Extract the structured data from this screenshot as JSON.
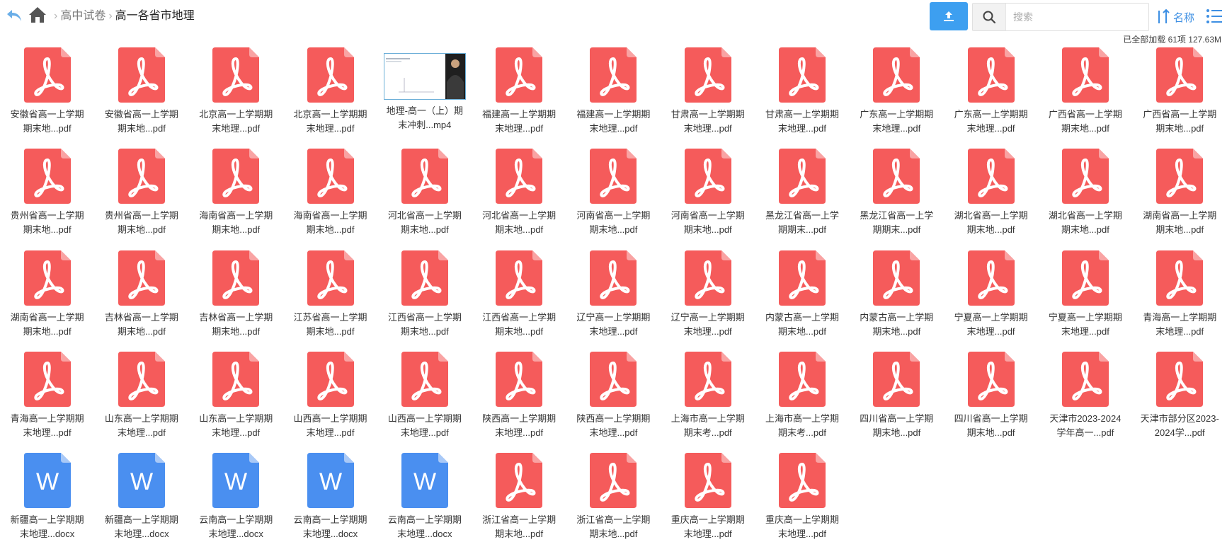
{
  "colors": {
    "pdf": "#f55b5b",
    "pdf_fold": "#f9a3a3",
    "word": "#4a8ff0",
    "word_fold": "#a9c9f7",
    "accent": "#3d9ff0",
    "link": "#3d8fe3"
  },
  "toolbar": {
    "back_icon": "back-arrow-icon",
    "home_icon": "home-icon",
    "upload_icon": "upload-icon",
    "search_icon": "magnifier-icon",
    "search_placeholder": "搜索",
    "sort_label": "名称",
    "sort_icon": "sort-ascending-icon",
    "view_icon": "list-view-icon"
  },
  "breadcrumb": {
    "parent": "高中试卷",
    "current": "高一各省市地理"
  },
  "status": "已全部加载 61项 127.63M",
  "files": [
    {
      "type": "pdf",
      "line1": "安徽省高一上学期",
      "line2": "期末地...pdf"
    },
    {
      "type": "pdf",
      "line1": "安徽省高一上学期",
      "line2": "期末地...pdf"
    },
    {
      "type": "pdf",
      "line1": "北京高一上学期期",
      "line2": "末地理...pdf"
    },
    {
      "type": "pdf",
      "line1": "北京高一上学期期",
      "line2": "末地理...pdf"
    },
    {
      "type": "mp4",
      "line1": "地理-高一（上）期",
      "line2": "末冲刺...mp4"
    },
    {
      "type": "pdf",
      "line1": "福建高一上学期期",
      "line2": "末地理...pdf"
    },
    {
      "type": "pdf",
      "line1": "福建高一上学期期",
      "line2": "末地理...pdf"
    },
    {
      "type": "pdf",
      "line1": "甘肃高一上学期期",
      "line2": "末地理...pdf"
    },
    {
      "type": "pdf",
      "line1": "甘肃高一上学期期",
      "line2": "末地理...pdf"
    },
    {
      "type": "pdf",
      "line1": "广东高一上学期期",
      "line2": "末地理...pdf"
    },
    {
      "type": "pdf",
      "line1": "广东高一上学期期",
      "line2": "末地理...pdf"
    },
    {
      "type": "pdf",
      "line1": "广西省高一上学期",
      "line2": "期末地...pdf"
    },
    {
      "type": "pdf",
      "line1": "广西省高一上学期",
      "line2": "期末地...pdf"
    },
    {
      "type": "pdf",
      "line1": "贵州省高一上学期",
      "line2": "期末地...pdf"
    },
    {
      "type": "pdf",
      "line1": "贵州省高一上学期",
      "line2": "期末地...pdf"
    },
    {
      "type": "pdf",
      "line1": "海南省高一上学期",
      "line2": "期末地...pdf"
    },
    {
      "type": "pdf",
      "line1": "海南省高一上学期",
      "line2": "期末地...pdf"
    },
    {
      "type": "pdf",
      "line1": "河北省高一上学期",
      "line2": "期末地...pdf"
    },
    {
      "type": "pdf",
      "line1": "河北省高一上学期",
      "line2": "期末地...pdf"
    },
    {
      "type": "pdf",
      "line1": "河南省高一上学期",
      "line2": "期末地...pdf"
    },
    {
      "type": "pdf",
      "line1": "河南省高一上学期",
      "line2": "期末地...pdf"
    },
    {
      "type": "pdf",
      "line1": "黑龙江省高一上学",
      "line2": "期期末...pdf"
    },
    {
      "type": "pdf",
      "line1": "黑龙江省高一上学",
      "line2": "期期末...pdf"
    },
    {
      "type": "pdf",
      "line1": "湖北省高一上学期",
      "line2": "期末地...pdf"
    },
    {
      "type": "pdf",
      "line1": "湖北省高一上学期",
      "line2": "期末地...pdf"
    },
    {
      "type": "pdf",
      "line1": "湖南省高一上学期",
      "line2": "期末地...pdf"
    },
    {
      "type": "pdf",
      "line1": "湖南省高一上学期",
      "line2": "期末地...pdf"
    },
    {
      "type": "pdf",
      "line1": "吉林省高一上学期",
      "line2": "期末地...pdf"
    },
    {
      "type": "pdf",
      "line1": "吉林省高一上学期",
      "line2": "期末地...pdf"
    },
    {
      "type": "pdf",
      "line1": "江苏省高一上学期",
      "line2": "期末地...pdf"
    },
    {
      "type": "pdf",
      "line1": "江西省高一上学期",
      "line2": "期末地...pdf"
    },
    {
      "type": "pdf",
      "line1": "江西省高一上学期",
      "line2": "期末地...pdf"
    },
    {
      "type": "pdf",
      "line1": "辽宁高一上学期期",
      "line2": "末地理...pdf"
    },
    {
      "type": "pdf",
      "line1": "辽宁高一上学期期",
      "line2": "末地理...pdf"
    },
    {
      "type": "pdf",
      "line1": "内蒙古高一上学期",
      "line2": "期末地...pdf"
    },
    {
      "type": "pdf",
      "line1": "内蒙古高一上学期",
      "line2": "期末地...pdf"
    },
    {
      "type": "pdf",
      "line1": "宁夏高一上学期期",
      "line2": "末地理...pdf"
    },
    {
      "type": "pdf",
      "line1": "宁夏高一上学期期",
      "line2": "末地理...pdf"
    },
    {
      "type": "pdf",
      "line1": "青海高一上学期期",
      "line2": "末地理...pdf"
    },
    {
      "type": "pdf",
      "line1": "青海高一上学期期",
      "line2": "末地理...pdf"
    },
    {
      "type": "pdf",
      "line1": "山东高一上学期期",
      "line2": "末地理...pdf"
    },
    {
      "type": "pdf",
      "line1": "山东高一上学期期",
      "line2": "末地理...pdf"
    },
    {
      "type": "pdf",
      "line1": "山西高一上学期期",
      "line2": "末地理...pdf"
    },
    {
      "type": "pdf",
      "line1": "山西高一上学期期",
      "line2": "末地理...pdf"
    },
    {
      "type": "pdf",
      "line1": "陕西高一上学期期",
      "line2": "末地理...pdf"
    },
    {
      "type": "pdf",
      "line1": "陕西高一上学期期",
      "line2": "末地理...pdf"
    },
    {
      "type": "pdf",
      "line1": "上海市高一上学期",
      "line2": "期末考...pdf"
    },
    {
      "type": "pdf",
      "line1": "上海市高一上学期",
      "line2": "期末考...pdf"
    },
    {
      "type": "pdf",
      "line1": "四川省高一上学期",
      "line2": "期末地...pdf"
    },
    {
      "type": "pdf",
      "line1": "四川省高一上学期",
      "line2": "期末地...pdf"
    },
    {
      "type": "pdf",
      "line1": "天津市2023-2024",
      "line2": "学年高一...pdf"
    },
    {
      "type": "pdf",
      "line1": "天津市部分区2023-",
      "line2": "2024学...pdf"
    },
    {
      "type": "docx",
      "line1": "新疆高一上学期期",
      "line2": "末地理...docx"
    },
    {
      "type": "docx",
      "line1": "新疆高一上学期期",
      "line2": "末地理...docx"
    },
    {
      "type": "docx",
      "line1": "云南高一上学期期",
      "line2": "末地理...docx"
    },
    {
      "type": "docx",
      "line1": "云南高一上学期期",
      "line2": "末地理...docx"
    },
    {
      "type": "docx",
      "line1": "云南高一上学期期",
      "line2": "末地理...docx"
    },
    {
      "type": "pdf",
      "line1": "浙江省高一上学期",
      "line2": "期末地...pdf"
    },
    {
      "type": "pdf",
      "line1": "浙江省高一上学期",
      "line2": "期末地...pdf"
    },
    {
      "type": "pdf",
      "line1": "重庆高一上学期期",
      "line2": "末地理...pdf"
    },
    {
      "type": "pdf",
      "line1": "重庆高一上学期期",
      "line2": "末地理...pdf"
    }
  ]
}
